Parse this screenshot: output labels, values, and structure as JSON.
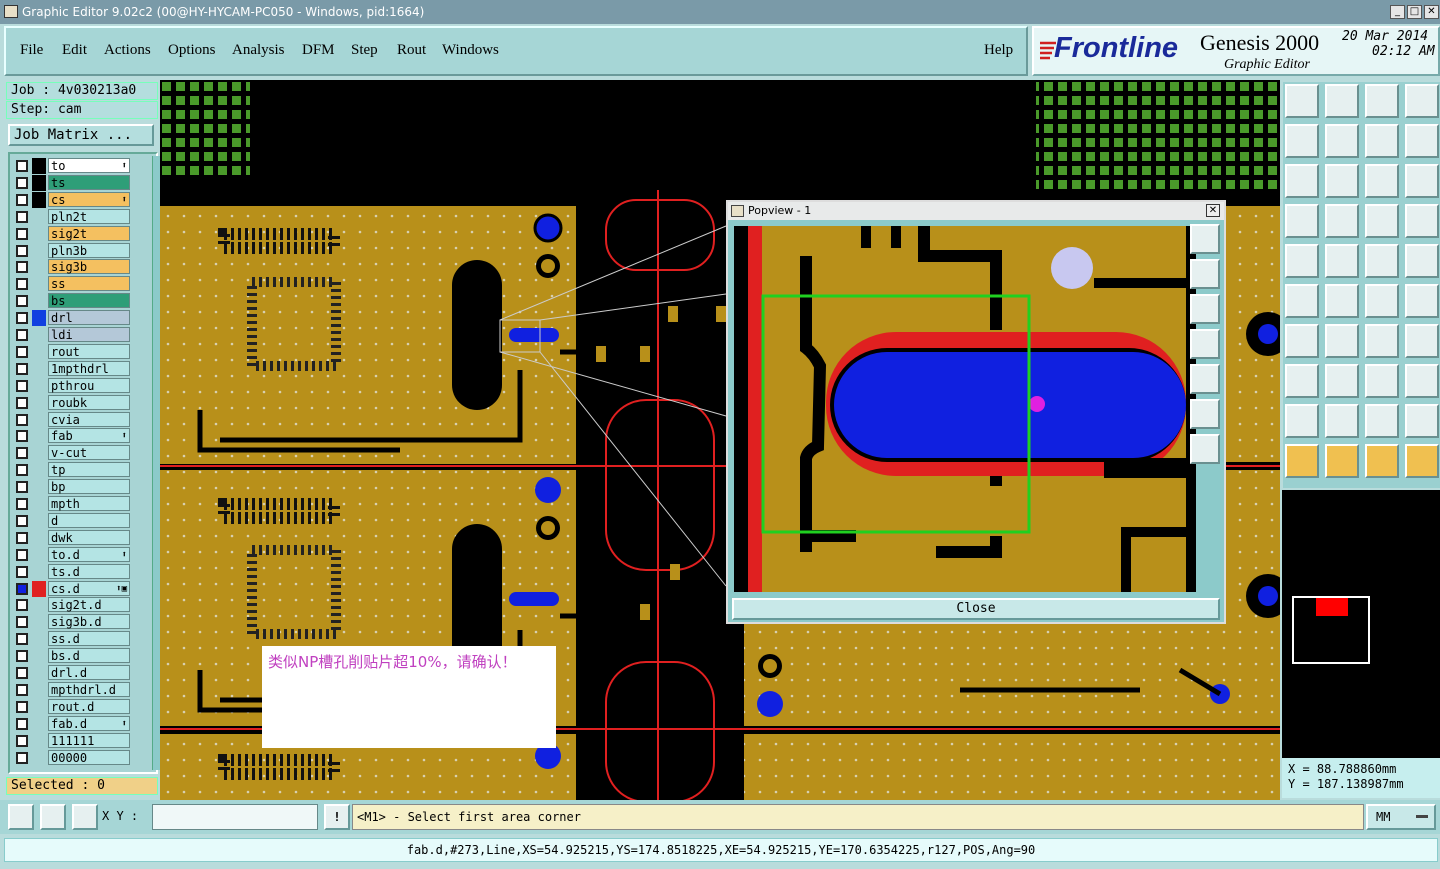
{
  "window": {
    "title": "Graphic Editor 9.02c2 (00@HY-HYCAM-PC050 - Windows, pid:1664)"
  },
  "menubar": {
    "items": [
      "File",
      "Edit",
      "Actions",
      "Options",
      "Analysis",
      "DFM",
      "Step",
      "Rout",
      "Windows"
    ],
    "help": "Help"
  },
  "brand": {
    "logo": "Frontline",
    "product": "Genesis 2000",
    "subtitle": "Graphic Editor",
    "date": "20 Mar 2014",
    "time": "02:12 AM"
  },
  "job": {
    "job_label": "Job : 4v030213a0",
    "step_label": "Step: cam",
    "matrix_button": "Job Matrix ..."
  },
  "layers": [
    {
      "name": "to",
      "color": "#ffffff",
      "tag": "⬆"
    },
    {
      "name": "ts",
      "color": "#2e9e78",
      "tag": ""
    },
    {
      "name": "cs",
      "color": "#f4c060",
      "tag": "⬆"
    },
    {
      "name": "pln2t",
      "color": "#b4e4e4",
      "tag": ""
    },
    {
      "name": "sig2t",
      "color": "#f4c060",
      "tag": ""
    },
    {
      "name": "pln3b",
      "color": "#b4e4e4",
      "tag": ""
    },
    {
      "name": "sig3b",
      "color": "#f4c060",
      "tag": ""
    },
    {
      "name": "ss",
      "color": "#f4c060",
      "tag": ""
    },
    {
      "name": "bs",
      "color": "#2e9e78",
      "tag": ""
    },
    {
      "name": "drl",
      "color": "#b4c8d8",
      "tag": ""
    },
    {
      "name": "ldi",
      "color": "#b4c8d8",
      "tag": ""
    },
    {
      "name": "rout",
      "color": "#b4e4e4",
      "tag": ""
    },
    {
      "name": "1mpthdrl",
      "color": "#b4e4e4",
      "tag": ""
    },
    {
      "name": "pthrou",
      "color": "#b4e4e4",
      "tag": ""
    },
    {
      "name": "roubk",
      "color": "#b4e4e4",
      "tag": ""
    },
    {
      "name": "cvia",
      "color": "#b4e4e4",
      "tag": ""
    },
    {
      "name": "fab",
      "color": "#b4e4e4",
      "tag": "⬆"
    },
    {
      "name": "v-cut",
      "color": "#b4e4e4",
      "tag": ""
    },
    {
      "name": "tp",
      "color": "#b4e4e4",
      "tag": ""
    },
    {
      "name": "bp",
      "color": "#b4e4e4",
      "tag": ""
    },
    {
      "name": "mpth",
      "color": "#b4e4e4",
      "tag": ""
    },
    {
      "name": "d",
      "color": "#b4e4e4",
      "tag": ""
    },
    {
      "name": "dwk",
      "color": "#b4e4e4",
      "tag": ""
    },
    {
      "name": "to.d",
      "color": "#b4e4e4",
      "tag": "⬆"
    },
    {
      "name": "ts.d",
      "color": "#b4e4e4",
      "tag": ""
    },
    {
      "name": "cs.d",
      "color": "#b4e4e4",
      "tag": "⬆▣"
    },
    {
      "name": "sig2t.d",
      "color": "#b4e4e4",
      "tag": ""
    },
    {
      "name": "sig3b.d",
      "color": "#b4e4e4",
      "tag": ""
    },
    {
      "name": "ss.d",
      "color": "#b4e4e4",
      "tag": ""
    },
    {
      "name": "bs.d",
      "color": "#b4e4e4",
      "tag": ""
    },
    {
      "name": "drl.d",
      "color": "#b4e4e4",
      "tag": ""
    },
    {
      "name": "mpthdrl.d",
      "color": "#b4e4e4",
      "tag": ""
    },
    {
      "name": "rout.d",
      "color": "#b4e4e4",
      "tag": ""
    },
    {
      "name": "fab.d",
      "color": "#b4e4e4",
      "tag": "⬆"
    },
    {
      "name": "111111",
      "color": "#b4e4e4",
      "tag": ""
    },
    {
      "name": "00000",
      "color": "#b4e4e4",
      "tag": ""
    }
  ],
  "selected": "Selected : 0",
  "popview": {
    "title": "Popview - 1",
    "close": "Close"
  },
  "note": {
    "text": "类似NP槽孔削贴片超10%，请确认！"
  },
  "coords": {
    "x": "X = 88.788860mm",
    "y": "Y = 187.138987mm"
  },
  "cmd": {
    "xy_label": "X Y :",
    "xy_value": "",
    "prompt": "<M1> - Select first area corner",
    "units": "MM"
  },
  "status": "fab.d,#273,Line,XS=54.925215,YS=174.8518225,XE=54.925215,YE=170.6354225,r127,POS,Ang=90",
  "colors": {
    "copper": "#b8901a",
    "board_bg": "#000000",
    "outline": "#e02020",
    "drill": "#1020e0",
    "ui": "#a6d6d6"
  }
}
